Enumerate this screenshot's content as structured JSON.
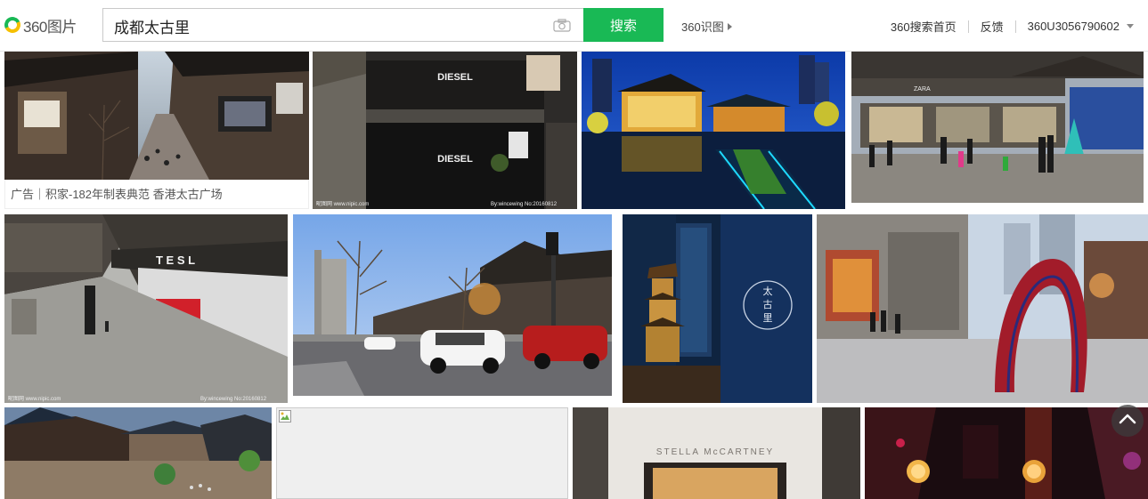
{
  "brand": {
    "logo_text": "360图片"
  },
  "search": {
    "value": "成都太古里",
    "button_label": "搜索"
  },
  "header": {
    "shitu_label": "360识图",
    "home_link": "360搜索首页",
    "feedback_link": "反馈",
    "user_name": "360U3056790602"
  },
  "results": {
    "ad_caption": "广告｜积家-182年制表典范 香港太古广场",
    "diesel_sign_1": "DIESEL",
    "diesel_sign_2": "DIESEL",
    "zara_sign": "ZARA",
    "tesla_sign": "T E S L",
    "taiguli_emblem": [
      "太",
      "古",
      "里"
    ],
    "stella_sign": "STELLA McCARTNEY",
    "watermark_left": "昵图网 www.nipic.com",
    "watermark_right": "By:wincewing No:20160812"
  },
  "colors": {
    "brand_green": "#19b955",
    "logo_yellow": "#f6c000"
  },
  "icons": [
    "camera-icon",
    "caret-right-icon",
    "chevron-down-icon",
    "chevron-up-icon",
    "broken-image-icon"
  ]
}
